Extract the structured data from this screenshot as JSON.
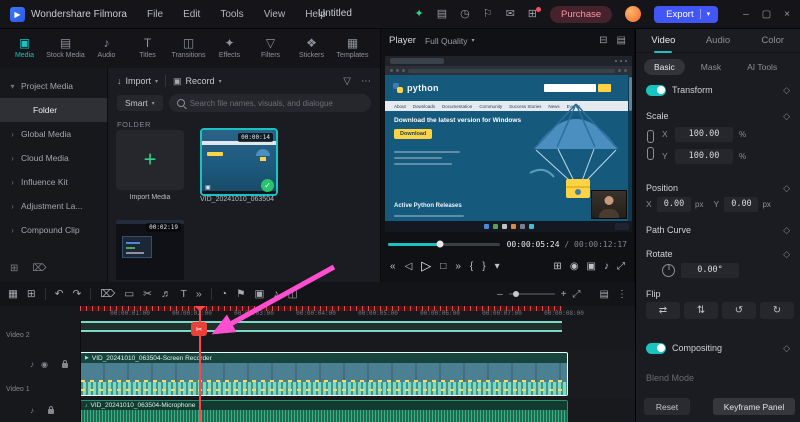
{
  "icons": {
    "caret_down": "▾",
    "logo_play": "▶",
    "check": "✓",
    "plus": "+",
    "import": "↓",
    "record": "▣",
    "clip_play": "▶",
    "scissors": "✂",
    "zoom_out": "–",
    "zoom_in": "+",
    "fit": "⤢",
    "mute": "♪",
    "eye": "◉"
  },
  "window": {
    "title_left": "Wondershare Filmora",
    "menus": [
      "File",
      "Edit",
      "Tools",
      "View",
      "Help"
    ],
    "project_title": "Untitled",
    "purchase": "Purchase",
    "export": "Export",
    "header_icons": [
      {
        "name": "gift-icon",
        "glyph": "✦",
        "cls": "accent"
      },
      {
        "name": "resources-icon",
        "glyph": "▤"
      },
      {
        "name": "history-icon",
        "glyph": "◷"
      },
      {
        "name": "feedback-icon",
        "glyph": "⚐"
      },
      {
        "name": "message-icon",
        "glyph": "✉"
      },
      {
        "name": "apps-icon",
        "glyph": "⊞",
        "cls": "badge"
      }
    ],
    "window_controls": [
      {
        "name": "minimize-button",
        "glyph": "–"
      },
      {
        "name": "maximize-button",
        "glyph": "▢"
      },
      {
        "name": "close-button",
        "glyph": "×"
      }
    ]
  },
  "media_tabs": [
    {
      "label": "Media",
      "glyph": "▣",
      "cls": "active"
    },
    {
      "label": "Stock Media",
      "glyph": "▤"
    },
    {
      "label": "Audio",
      "glyph": "♪"
    },
    {
      "label": "Titles",
      "glyph": "T"
    },
    {
      "label": "Transitions",
      "glyph": "◫"
    },
    {
      "label": "Effects",
      "glyph": "✦"
    },
    {
      "label": "Filters",
      "glyph": "▽"
    },
    {
      "label": "Stickers",
      "glyph": "❖"
    },
    {
      "label": "Templates",
      "glyph": "▦"
    }
  ],
  "folders": {
    "items": [
      {
        "label": "Project Media",
        "glyph": "▾"
      },
      {
        "label": "Folder",
        "glyph": "",
        "cls": "indent active"
      },
      {
        "label": "Global Media",
        "glyph": "›"
      },
      {
        "label": "Cloud Media",
        "glyph": "›"
      },
      {
        "label": "Influence Kit",
        "glyph": "›"
      },
      {
        "label": "Adjustment La...",
        "glyph": "›"
      },
      {
        "label": "Compound Clip",
        "glyph": "›"
      }
    ],
    "bottom_icons": [
      {
        "name": "new-folder-icon",
        "glyph": "⊞"
      },
      {
        "name": "delete-icon",
        "glyph": "⌦"
      }
    ]
  },
  "media_browser": {
    "import_label": "Import",
    "record_label": "Record",
    "smart_label": "Smart",
    "search_placeholder": "Search file names, visuals, and dialogue",
    "folder_label": "FOLDER",
    "top_icons": [
      {
        "name": "filter-icon",
        "glyph": "▽"
      },
      {
        "name": "more-icon",
        "glyph": "⋯"
      }
    ],
    "import_tile_label": "Import Media",
    "clip1_name": "VID_20241010_063504",
    "clip1_duration": "00:00:14",
    "clip2_duration": "00:02:19"
  },
  "player": {
    "label": "Player",
    "quality": "Full Quality",
    "head_icons": [
      {
        "name": "split-view-icon",
        "glyph": "⊟"
      },
      {
        "name": "scopes-icon",
        "glyph": "▤"
      }
    ],
    "current_time": "00:00:05:24",
    "separator": " / ",
    "total_time": "00:00:12:17",
    "progress_percent": 46,
    "page": {
      "logo": "python",
      "nav": [
        "About",
        "Downloads",
        "Documentation",
        "Community",
        "Success Stories",
        "News",
        "Events"
      ],
      "headline": "Download the latest version for Windows",
      "button": "Download",
      "subheading": "Active Python Releases"
    },
    "transport_left": [
      {
        "name": "prev-frame-button",
        "glyph": "«"
      },
      {
        "name": "step-back-button",
        "glyph": "◁"
      },
      {
        "name": "play-button",
        "glyph": "▷",
        "cls": "big"
      },
      {
        "name": "stop-button",
        "glyph": "□"
      },
      {
        "name": "next-frame-button",
        "glyph": "»"
      },
      {
        "name": "mark-in-button",
        "glyph": "{"
      },
      {
        "name": "mark-out-button",
        "glyph": "}"
      },
      {
        "name": "more-options-button",
        "glyph": "▾"
      }
    ],
    "transport_right": [
      {
        "name": "preview-quality-button",
        "glyph": "⊞"
      },
      {
        "name": "snapshot-button",
        "glyph": "◉"
      },
      {
        "name": "record-button",
        "glyph": "▣"
      },
      {
        "name": "mute-button",
        "glyph": "♪"
      },
      {
        "name": "fullscreen-button",
        "glyph": "⤢"
      }
    ]
  },
  "properties": {
    "tabs": [
      {
        "label": "Video",
        "cls": "active"
      },
      {
        "label": "Audio"
      },
      {
        "label": "Color"
      }
    ],
    "subtabs": [
      {
        "label": "Basic",
        "cls": "active"
      },
      {
        "label": "Mask"
      },
      {
        "label": "AI Tools"
      }
    ],
    "transform": "Transform",
    "scale": "Scale",
    "x": "X",
    "y": "Y",
    "scale_x": "100.00",
    "scale_y": "100.00",
    "percent": "%",
    "position": "Position",
    "pos_x": "0.00",
    "pos_y": "0.00",
    "px": "px",
    "path_curve": "Path Curve",
    "rotate": "Rotate",
    "rotate_value": "0.00°",
    "flip": "Flip",
    "flip_buttons": [
      {
        "name": "flip-horizontal-button",
        "glyph": "⇄"
      },
      {
        "name": "flip-vertical-button",
        "glyph": "⇅"
      },
      {
        "name": "rotate-ccw-button",
        "glyph": "↺"
      },
      {
        "name": "rotate-cw-button",
        "glyph": "↻"
      }
    ],
    "compositing": "Compositing",
    "blend_mode": "Blend Mode",
    "reset": "Reset",
    "keyframe_panel": "Keyframe Panel"
  },
  "timeline": {
    "toolbar": {
      "g1": [
        {
          "name": "track-manage-icon",
          "glyph": "▦"
        },
        {
          "name": "auto-ripple-icon",
          "glyph": "⊞"
        }
      ],
      "g2": [
        {
          "name": "undo-button",
          "glyph": "↶"
        },
        {
          "name": "redo-button",
          "glyph": "↷"
        }
      ],
      "g3": [
        {
          "name": "delete-button",
          "glyph": "⌦"
        },
        {
          "name": "crop-button",
          "glyph": "▭"
        },
        {
          "name": "split-button",
          "glyph": "✂"
        },
        {
          "name": "detach-audio-button",
          "glyph": "♬"
        },
        {
          "name": "add-text-button",
          "glyph": "T"
        },
        {
          "name": "more-tools-button",
          "glyph": "»"
        }
      ],
      "g4": [
        {
          "name": "speed-button",
          "glyph": "◔"
        },
        {
          "name": "marker-button",
          "glyph": "⚑"
        },
        {
          "name": "screen-record-button",
          "glyph": "▣"
        },
        {
          "name": "voiceover-button",
          "glyph": "♪"
        },
        {
          "name": "mixer-button",
          "glyph": "◫"
        }
      ],
      "right": [
        {
          "name": "timeline-settings-icon",
          "glyph": "▤"
        },
        {
          "name": "more-icon",
          "glyph": "⋮"
        }
      ]
    },
    "zoom_level_percent": 15,
    "ruler": [
      "00:00:01:00",
      "00:00:02:00",
      "00:00:03:00",
      "00:00:04:00",
      "00:00:05:00",
      "00:00:06:00",
      "00:00:07:00",
      "00:00:08:00"
    ],
    "tracks": {
      "video2_label": "Video 2",
      "video1_label": "Video 1",
      "video1_icons": [
        {
          "name": "mute-icon",
          "glyph": "♪"
        },
        {
          "name": "hide-icon",
          "glyph": "◉"
        }
      ],
      "audio_icons": [
        {
          "name": "mute-icon",
          "glyph": "♪"
        }
      ]
    },
    "clips": {
      "video_name": "VID_20241010_063504-Screen Recorder",
      "audio_name": "VID_20241010_063504-Microphone"
    }
  },
  "colors": {
    "accent": "#19c3c0",
    "export_blue": "#4156f4",
    "clip_teal": "#7cd9c6",
    "playhead_red": "#ff4646",
    "arrow_pink": "#ff4fd0",
    "import_green": "#2fd07f"
  }
}
